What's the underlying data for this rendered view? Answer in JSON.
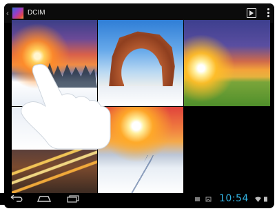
{
  "action_bar": {
    "title": "DCIM",
    "app_icon": "gallery-app-icon",
    "slideshow_icon": "slideshow-play-icon",
    "overflow_icon": "overflow-menu-icon"
  },
  "grid": {
    "thumbnails": [
      {
        "name": "sunrise-snowy-trees"
      },
      {
        "name": "red-rock-arch"
      },
      {
        "name": "sunburst-field"
      },
      {
        "name": "snow-covered-field"
      },
      {
        "name": "night-light-trails"
      },
      {
        "name": "sunset-snow-footprints"
      }
    ]
  },
  "overlay": {
    "icon": "pointing-hand-icon"
  },
  "system_bar": {
    "clock": "10:54",
    "icons": [
      "back-nav-icon",
      "home-nav-icon",
      "recent-apps-icon",
      "notification-icon",
      "gallery-notification-icon",
      "wifi-icon",
      "battery-icon"
    ],
    "accent": "#33b5e5"
  }
}
